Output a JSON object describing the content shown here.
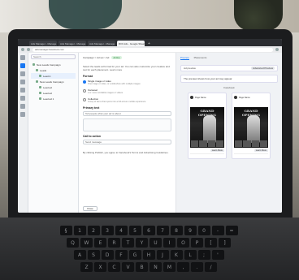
{
  "browser": {
    "tabs": [
      {
        "label": "Ads Manager - Manage Ads"
      },
      {
        "label": "Ads Manager - Manage Ads"
      },
      {
        "label": "Ads Manager - Manage Ads"
      },
      {
        "label": "ROI Ads - Google Sheets"
      }
    ],
    "url": "adsmanager.facebook.com"
  },
  "tree": {
    "search_placeholder": "Search",
    "items": [
      {
        "label": "New Leads Campaign",
        "level": 1
      },
      {
        "label": "Leads",
        "level": 2
      },
      {
        "label": "Lead A",
        "level": 3
      },
      {
        "label": "New Leads Campaign",
        "level": 2
      },
      {
        "label": "Lead ad",
        "level": 3
      },
      {
        "label": "Lead ad",
        "level": 3
      },
      {
        "label": "Lead ad 1",
        "level": 3
      }
    ]
  },
  "editor": {
    "crumb_text": "Campaign > Ad set > Ad",
    "status_pill": "Active",
    "help_text": "Select the leads ad format for your ad. You can also customize your creative and text for each placement. Learn more",
    "format_title": "Format",
    "options": [
      {
        "label": "Single image or video",
        "sub": "One image or video, or a slideshow with multiple images"
      },
      {
        "label": "Carousel",
        "sub": "2 or more scrollable images or videos"
      },
      {
        "label": "Collection",
        "sub": "Group of items that opens into a full-screen mobile experience"
      }
    ],
    "primary_label": "Primary text",
    "primary_placeholder": "Tell people what your ad is about",
    "cta_label": "Call to action",
    "cta_value": "Send message",
    "note_text": "By clicking Publish, you agree to Facebook's Terms and Advertising Guidelines.",
    "close_label": "Close",
    "save_label": "Save draft",
    "publish_label": "Publish"
  },
  "preview": {
    "tabs": [
      "Preview",
      "Placements"
    ],
    "header_left": "Ad preview",
    "header_right": "Advanced Preview",
    "note": "The preview shows how your ad may appear",
    "group_label": "Facebook",
    "cards": [
      {
        "page": "Page Name",
        "headline": "GRAND OPENING",
        "cta": "Learn More"
      },
      {
        "page": "Page Name",
        "headline": "GRAND OPENING",
        "cta": "Learn More"
      }
    ]
  },
  "keyboard": {
    "row1": [
      "§",
      "1",
      "2",
      "3",
      "4",
      "5",
      "6",
      "7",
      "8",
      "9",
      "0",
      "-",
      "="
    ],
    "row2": [
      "Q",
      "W",
      "E",
      "R",
      "T",
      "Y",
      "U",
      "I",
      "O",
      "P",
      "[",
      "]"
    ],
    "row3": [
      "A",
      "S",
      "D",
      "F",
      "G",
      "H",
      "J",
      "K",
      "L",
      ";",
      "'"
    ],
    "row4": [
      "Z",
      "X",
      "C",
      "V",
      "B",
      "N",
      "M",
      ",",
      ".",
      "/"
    ]
  }
}
